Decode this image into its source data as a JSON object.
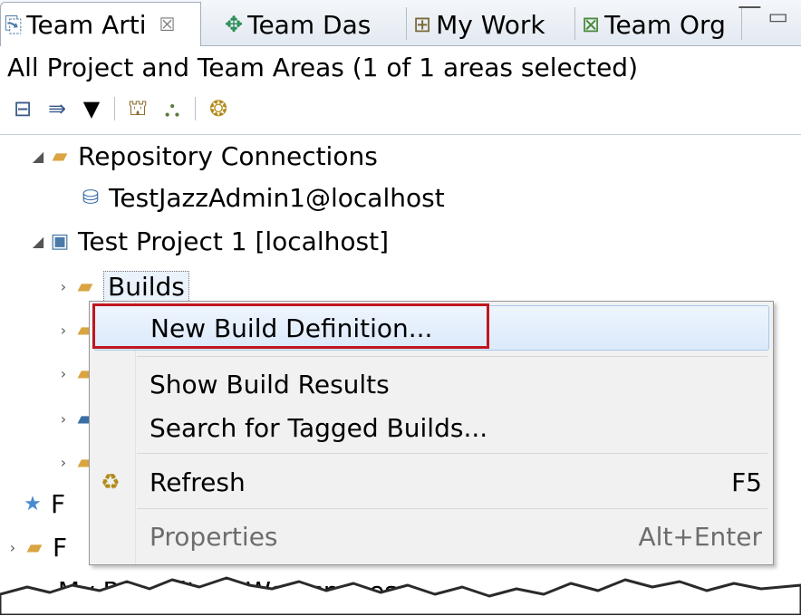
{
  "tabs": [
    {
      "label": "Team Arti",
      "icon": "team-artifacts-icon",
      "active": true,
      "close": "☒"
    },
    {
      "label": "Team Das",
      "icon": "team-dashboard-icon"
    },
    {
      "label": "My Work",
      "icon": "my-work-icon"
    },
    {
      "label": "Team Org",
      "icon": "team-org-icon"
    }
  ],
  "view_buttons": [
    "minimize-icon",
    "maximize-icon"
  ],
  "scope_label": "All Project and Team Areas (1 of 1 areas selected)",
  "toolbar": [
    "collapse-all-icon",
    "filter-icon",
    "view-menu-icon",
    "project-area-icon",
    "team-area-icon",
    "help-icon"
  ],
  "tree": {
    "repo_connections": "Repository Connections",
    "connection": "TestJazzAdmin1@localhost",
    "project": "Test Project 1 [localhost]",
    "builds": "Builds",
    "partial_f1": "F",
    "partial_f2": "F",
    "partial_bottom": "My Repository Workspaces"
  },
  "context_menu": {
    "new_build_definition": "New Build Definition...",
    "show_build_results": "Show Build Results",
    "search_tagged_builds": "Search for Tagged Builds...",
    "refresh": "Refresh",
    "refresh_accel": "F5",
    "properties": "Properties",
    "properties_accel": "Alt+Enter"
  },
  "colors": {
    "highlight_border": "#c0161f",
    "hover_bg": "#dbe9fa",
    "menu_bg": "#f1f1f1"
  }
}
